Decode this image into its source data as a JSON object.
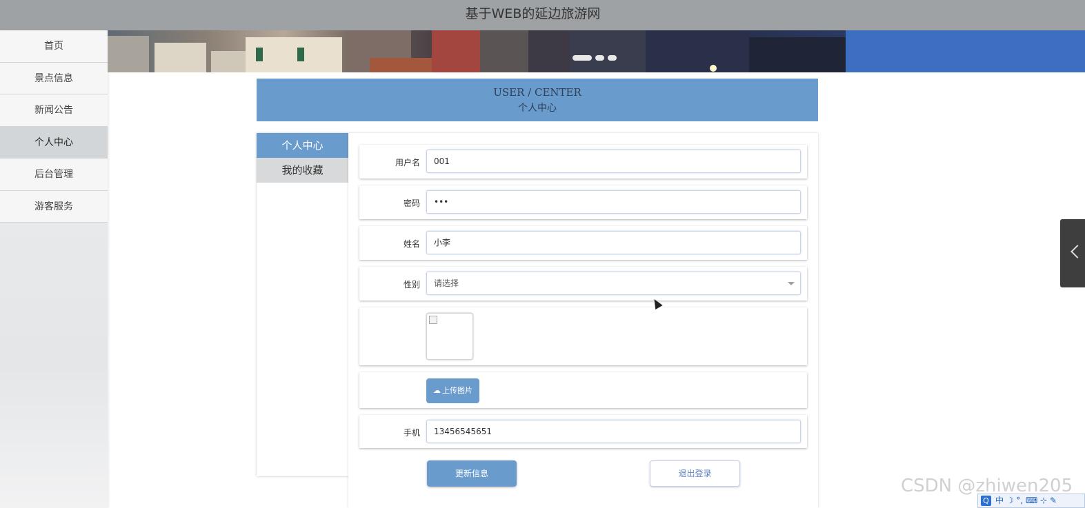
{
  "header": {
    "site_title": "基于WEB的延边旅游网"
  },
  "nav": {
    "items": [
      {
        "label": "首页",
        "active": false
      },
      {
        "label": "景点信息",
        "active": false
      },
      {
        "label": "新闻公告",
        "active": false
      },
      {
        "label": "个人中心",
        "active": true
      },
      {
        "label": "后台管理",
        "active": false
      },
      {
        "label": "游客服务",
        "active": false
      }
    ]
  },
  "banner": {
    "dot_count": 3,
    "active_dot": 1
  },
  "center_header": {
    "en": "USER / CENTER",
    "cn": "个人中心"
  },
  "left_menu": {
    "items": [
      {
        "label": "个人中心",
        "active": true
      },
      {
        "label": "我的收藏",
        "active": false
      }
    ]
  },
  "form": {
    "username": {
      "label": "用户名",
      "value": "001"
    },
    "password": {
      "label": "密码",
      "value": "•••"
    },
    "name": {
      "label": "姓名",
      "value": "小李"
    },
    "gender": {
      "label": "性别",
      "value": "请选择"
    },
    "upload_label": "上传图片",
    "phone": {
      "label": "手机",
      "value": "13456545651"
    },
    "update_button": "更新信息",
    "logout_button": "退出登录"
  },
  "overlay": {
    "watermark": "CSDN @zhiwen205",
    "ime_text": "中 ☽ °, ⌨ ⊹ ✎"
  },
  "colors": {
    "accent": "#6a9bcd",
    "topbar": "#9ea2a4",
    "nav_active": "#d3d6d8"
  },
  "icons": {
    "upload": "cloud-upload-icon",
    "side_tab": "chevron-left-icon",
    "select": "caret-down-icon"
  }
}
